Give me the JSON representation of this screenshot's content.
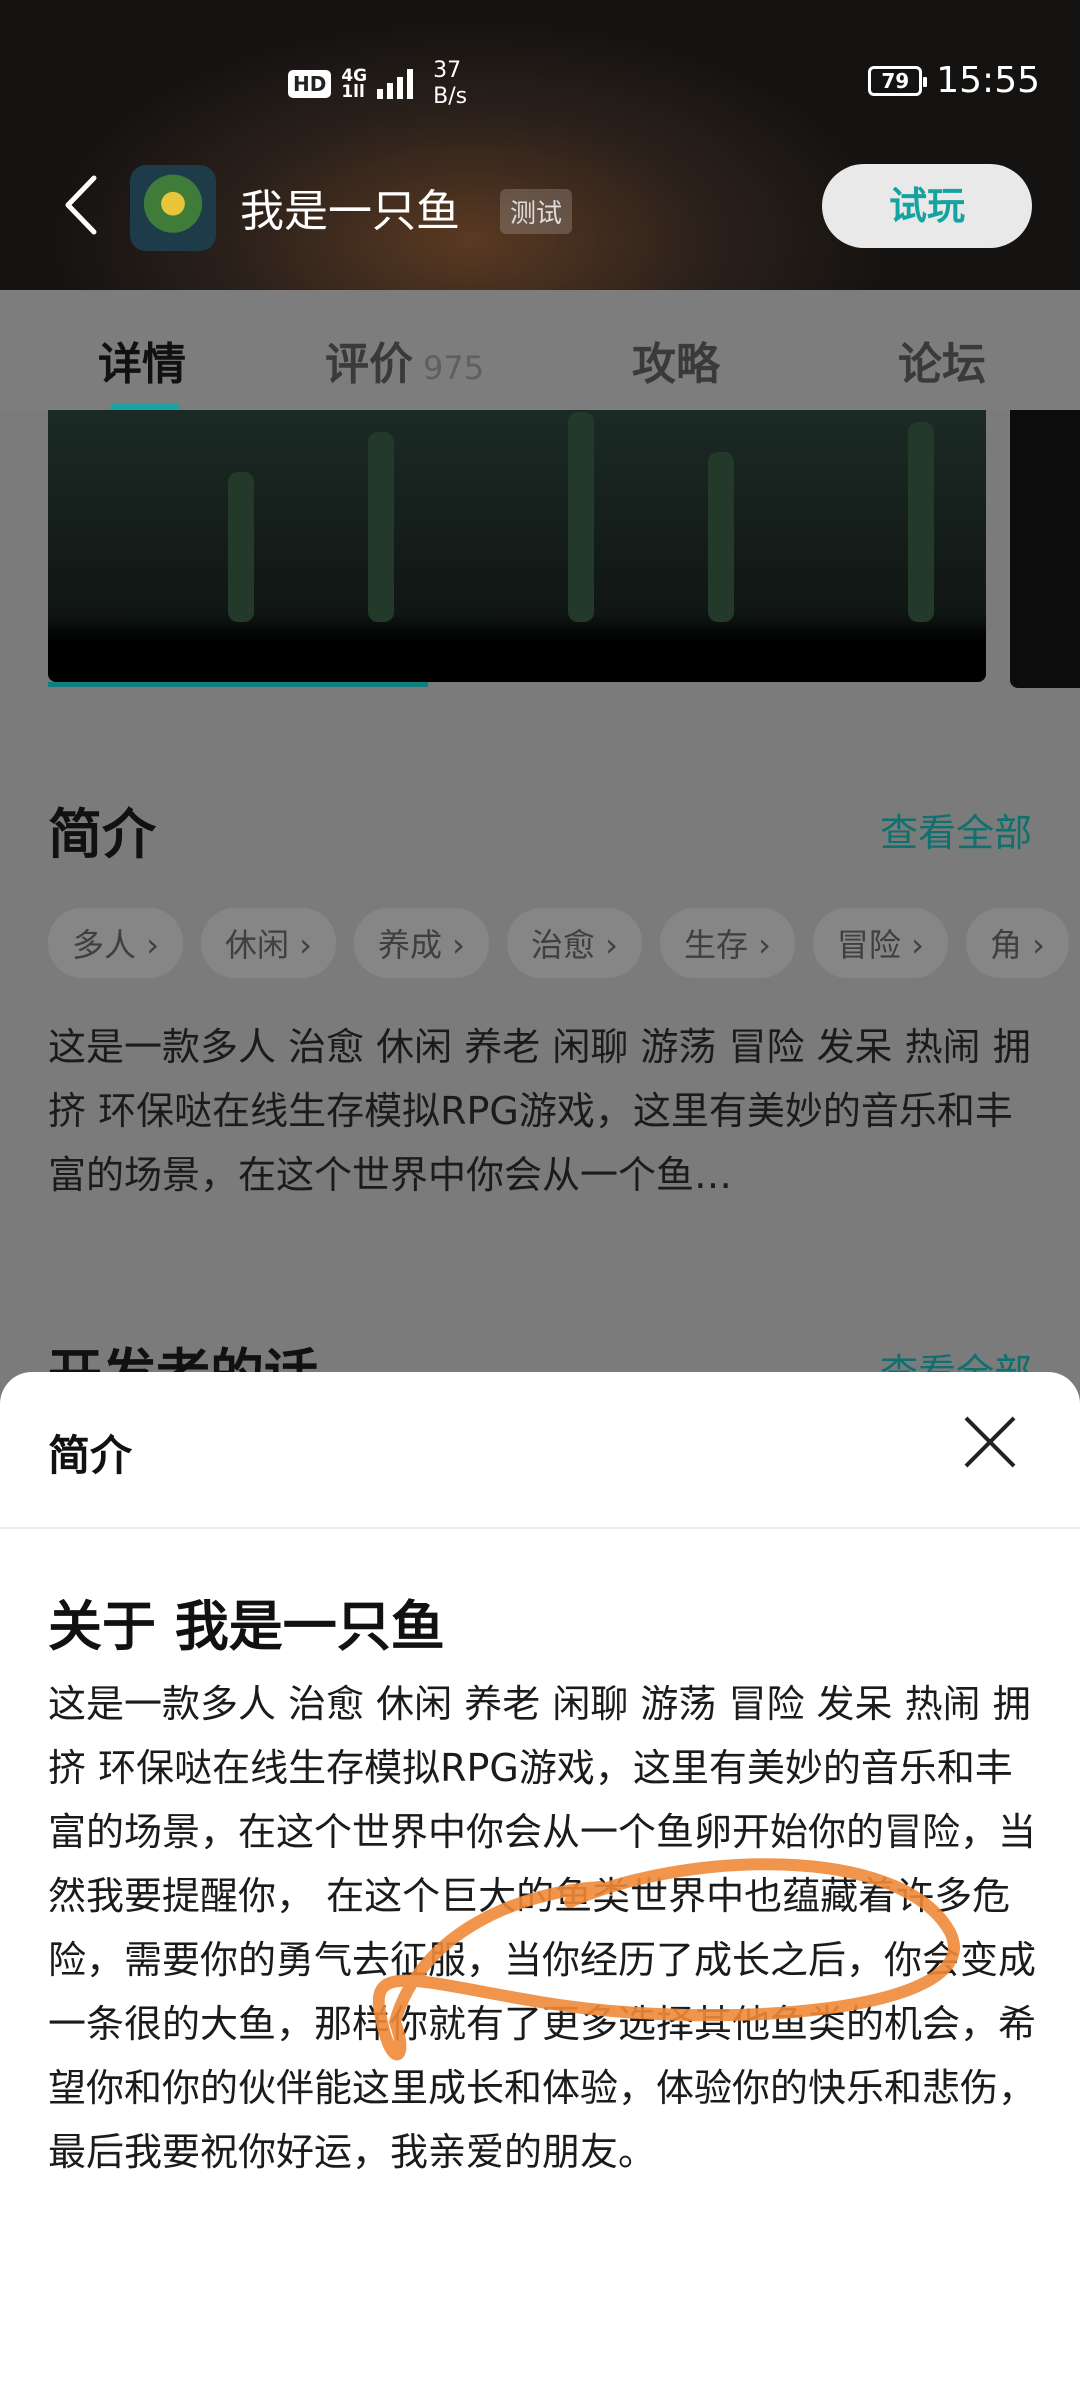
{
  "status_bar": {
    "hd": "HD",
    "signal_top": "4G",
    "signal_bottom": "1ll",
    "net_speed_value": "37",
    "net_speed_unit": "B/s",
    "battery": "79",
    "time": "15:55"
  },
  "header": {
    "app_title": "我是一只鱼",
    "tag": "测试",
    "try_button": "试玩"
  },
  "tabs": [
    {
      "label": "详情",
      "active": true
    },
    {
      "label": "评价",
      "count": "975"
    },
    {
      "label": "攻略"
    },
    {
      "label": "论坛"
    }
  ],
  "intro_section": {
    "title": "简介",
    "see_all": "查看全部",
    "chips": [
      "多人",
      "休闲",
      "养成",
      "治愈",
      "生存",
      "冒险",
      "角"
    ],
    "text": "这是一款多人 治愈 休闲 养老 闲聊 游荡 冒险 发呆 热闹 拥挤 环保哒在线生存模拟RPG游戏，这里有美妙的音乐和丰富的场景，在这个世界中你会从一个鱼…"
  },
  "developer_section": {
    "title": "开发者的话",
    "see_all": "查看全部"
  },
  "sheet": {
    "title": "简介",
    "about_title": "关于 我是一只鱼",
    "body": "这是一款多人 治愈 休闲 养老 闲聊 游荡 冒险 发呆 热闹 拥挤 环保哒在线生存模拟RPG游戏，这里有美妙的音乐和丰富的场景，在这个世界中你会从一个鱼卵开始你的冒险，当然我要提醒你， 在这个巨大的鱼类世界中也蕴藏着许多危险，需要你的勇气去征服，当你经历了成长之后，你会变成一条很的大鱼，那样你就有了更多选择其他鱼类的机会，希望你和你的伙伴能这里成长和体验，体验你的快乐和悲伤，最后我要祝你好运，我亲爱的朋友。"
  },
  "colors": {
    "accent": "#1aa3a3",
    "annotation_stroke": "#f08a3a"
  }
}
